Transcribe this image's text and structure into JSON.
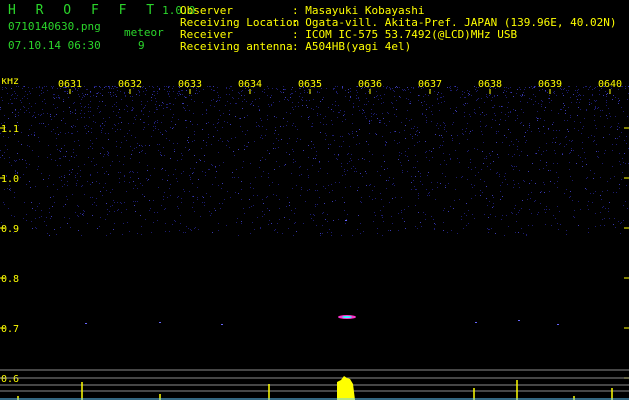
{
  "app": {
    "name": "H R O F F T",
    "version": "1.0.0",
    "filename": "0710140630.png",
    "datetime": "07.10.14 06:30",
    "meteor_label": "meteor",
    "meteor_count": "9"
  },
  "info": [
    {
      "key": "Observer",
      "value": ": Masayuki Kobayashi"
    },
    {
      "key": "Receiving Location",
      "value": ": Ogata-vill. Akita-Pref. JAPAN (139.96E, 40.02N)"
    },
    {
      "key": "Receiver",
      "value": ": ICOM IC-575 53.7492(@LCD)MHz USB"
    },
    {
      "key": "Receiving antenna",
      "value": ": A504HB(yagi 4el)"
    }
  ],
  "axis": {
    "unit": "kHz",
    "y_ticks": [
      "1.1",
      "1.0",
      "0.9",
      "0.8",
      "0.7",
      "0.6"
    ],
    "x_ticks": [
      "0631",
      "0632",
      "0633",
      "0634",
      "0635",
      "0636",
      "0637",
      "0638",
      "0639",
      "0640"
    ]
  },
  "colors": {
    "background": "#000000",
    "text_green": "#2bd62b",
    "text_yellow": "#ffff00",
    "text_cyan": "#66ccff",
    "noise": "#1a1a66",
    "signal_bar": "#ffff00"
  }
}
